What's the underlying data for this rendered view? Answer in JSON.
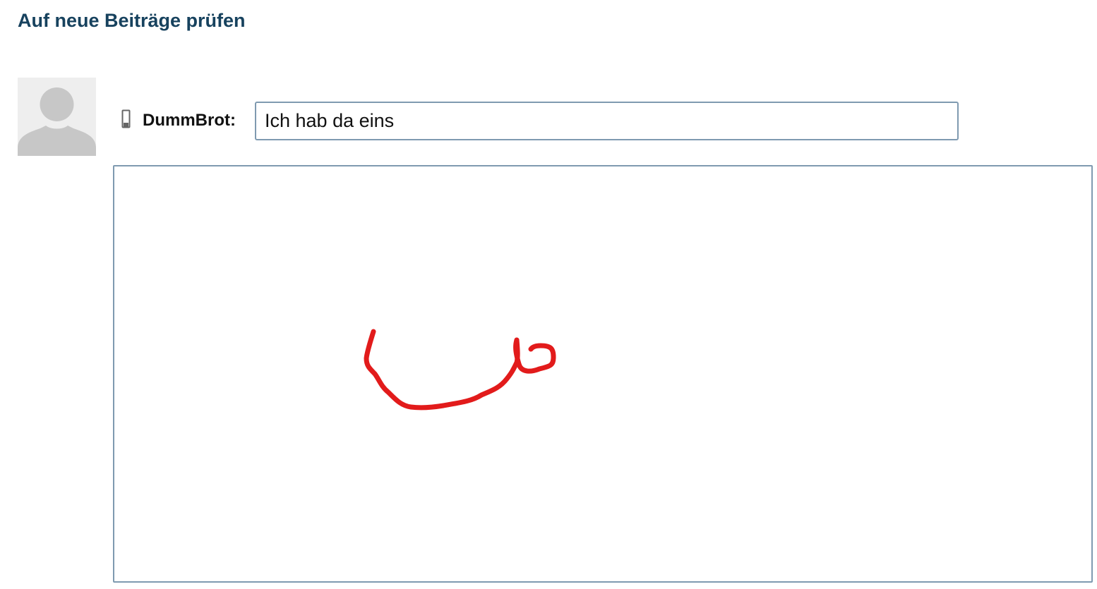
{
  "header": {
    "check_new_posts_label": "Auf neue Beiträge prüfen"
  },
  "post": {
    "username": "DummBrot:",
    "title_value": "Ich hab da eins",
    "device_icon": "mobile-phone-icon",
    "avatar_icon": "default-user-silhouette"
  },
  "drawing": {
    "stroke_color": "#e21b1b",
    "canvas_background": "#ffffff"
  },
  "colors": {
    "link": "#17425e",
    "border": "#7f9ab0",
    "avatar_bg": "#eeeeee",
    "avatar_fg": "#c7c7c7"
  }
}
